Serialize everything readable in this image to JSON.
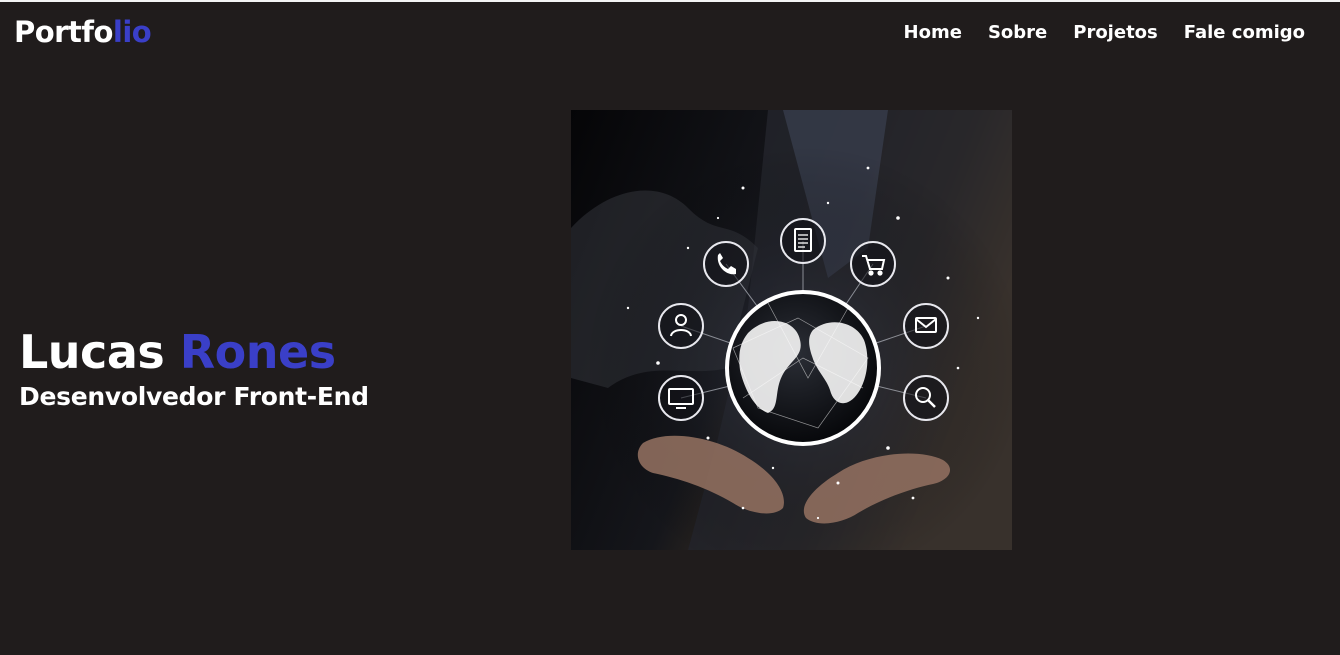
{
  "header": {
    "logo_main": "Portfo",
    "logo_accent": "lio",
    "nav": [
      {
        "label": "Home"
      },
      {
        "label": "Sobre"
      },
      {
        "label": "Projetos"
      },
      {
        "label": "Fale comigo"
      }
    ]
  },
  "hero": {
    "first_name": "Lucas",
    "last_name": "Rones",
    "role": "Desenvolvedor Front-End",
    "image_icons": [
      "phone-icon",
      "document-icon",
      "cart-icon",
      "user-icon",
      "mail-icon",
      "monitor-icon",
      "search-icon",
      "globe-icon"
    ]
  },
  "colors": {
    "background": "#201c1c",
    "accent": "#3a3fc8",
    "text": "#ffffff"
  }
}
